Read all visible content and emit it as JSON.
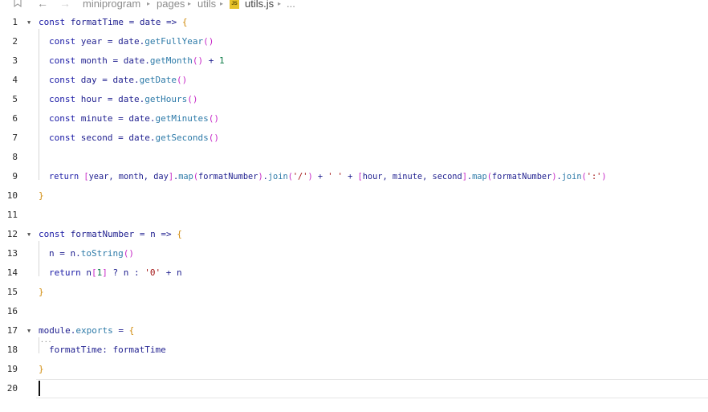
{
  "breadcrumb": {
    "back_icon": "arrow-left-icon",
    "forward_icon": "arrow-right-icon",
    "bookmark_icon": "bookmark-icon",
    "items": [
      "miniprogram",
      "pages",
      "utils",
      "utils.js",
      "..."
    ],
    "file_badge": "JS"
  },
  "colors": {
    "keyword": "#1a1aa6",
    "method": "#2d7aa8",
    "bracket": "#c728c7",
    "brace": "#d08a0a",
    "number": "#0a7a45",
    "string": "#a31515"
  },
  "lines": [
    {
      "n": "1",
      "text": "const formatTime = date => {"
    },
    {
      "n": "2",
      "text": "const year = date.getFullYear()"
    },
    {
      "n": "3",
      "text": "const month = date.getMonth() + 1"
    },
    {
      "n": "4",
      "text": "const day = date.getDate()"
    },
    {
      "n": "5",
      "text": "const hour = date.getHours()"
    },
    {
      "n": "6",
      "text": "const minute = date.getMinutes()"
    },
    {
      "n": "7",
      "text": "const second = date.getSeconds()"
    },
    {
      "n": "8",
      "text": ""
    },
    {
      "n": "9",
      "text": "return [year, month, day].map(formatNumber).join('/') + ' ' + [hour, minute, second].map(formatNumber).join(':')"
    },
    {
      "n": "10",
      "text": "}"
    },
    {
      "n": "11",
      "text": ""
    },
    {
      "n": "12",
      "text": "const formatNumber = n => {"
    },
    {
      "n": "13",
      "text": "n = n.toString()"
    },
    {
      "n": "14",
      "text": "return n[1] ? n : '0' + n"
    },
    {
      "n": "15",
      "text": "}"
    },
    {
      "n": "16",
      "text": ""
    },
    {
      "n": "17",
      "text": "module.exports = {"
    },
    {
      "n": "18",
      "text": "formatTime: formatTime"
    },
    {
      "n": "19",
      "text": "}"
    },
    {
      "n": "20",
      "text": ""
    }
  ]
}
